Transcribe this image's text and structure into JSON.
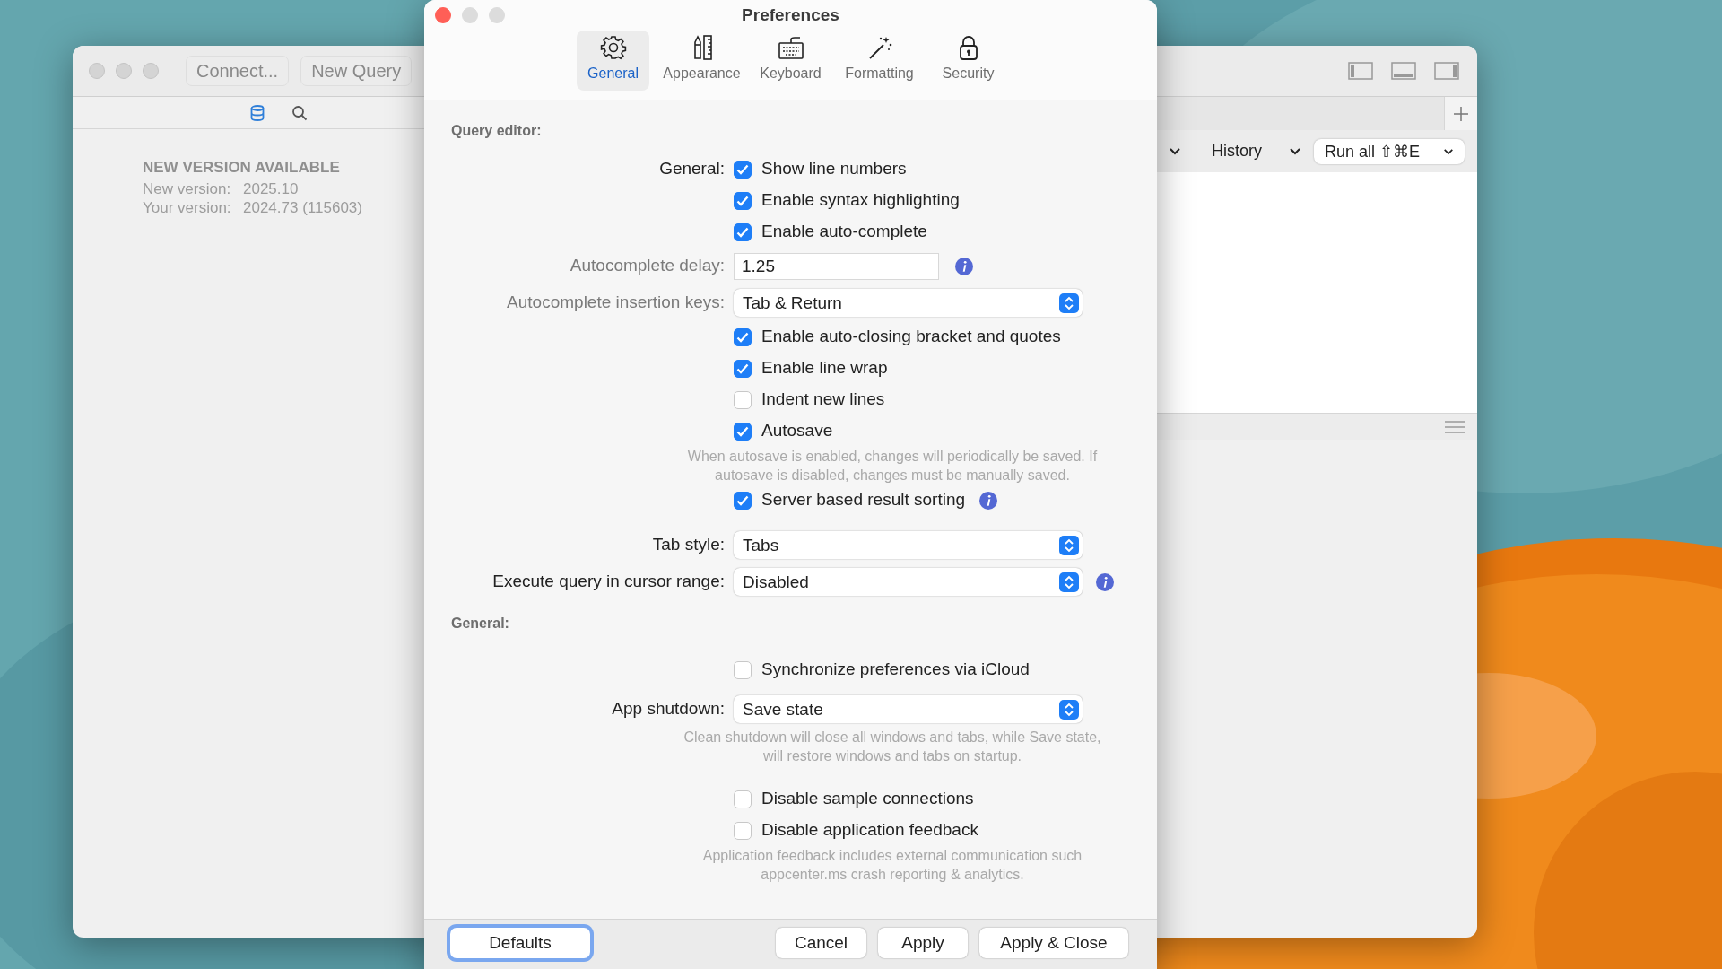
{
  "left_window": {
    "toolbar_buttons": [
      "Connect...",
      "New Query"
    ],
    "sidebar_tabs": [
      {
        "kind": "database",
        "selected": true
      },
      {
        "kind": "search",
        "selected": false
      }
    ],
    "notice": {
      "title": "NEW VERSION AVAILABLE",
      "rows": [
        {
          "label": "New version:",
          "value": "2025.10"
        },
        {
          "label": "Your version:",
          "value": "2024.73 (115603)"
        }
      ]
    }
  },
  "right_window": {
    "menus": [
      {
        "kind": "cut"
      },
      {
        "kind": "full",
        "label": "History"
      }
    ],
    "run_button": "Run all ⇧⌘E"
  },
  "prefs": {
    "title": "Preferences",
    "tabs": [
      {
        "kind": "gear",
        "label": "General",
        "selected": true
      },
      {
        "kind": "pencil",
        "label": "Appearance",
        "selected": false
      },
      {
        "kind": "keyboard",
        "label": "Keyboard",
        "selected": false
      },
      {
        "kind": "wand",
        "label": "Formatting",
        "selected": false
      },
      {
        "kind": "lock",
        "label": "Security",
        "selected": false
      }
    ],
    "sections": [
      {
        "heading": "Query editor:",
        "rows": [
          {
            "kind": "check",
            "label": "General:",
            "text": "Show line numbers",
            "checked": true
          },
          {
            "kind": "check",
            "text": "Enable syntax highlighting",
            "checked": true
          },
          {
            "kind": "check",
            "text": "Enable auto-complete",
            "checked": true
          },
          {
            "kind": "field",
            "label": "Autocomplete delay:",
            "label_dimmed": true,
            "value": "1.25",
            "info": true
          },
          {
            "kind": "select",
            "label": "Autocomplete insertion keys:",
            "label_dimmed": true,
            "value": "Tab & Return",
            "info": false
          },
          {
            "kind": "check",
            "text": "Enable auto-closing bracket and quotes",
            "checked": true
          },
          {
            "kind": "check",
            "text": "Enable line wrap",
            "checked": true
          },
          {
            "kind": "check",
            "text": "Indent new lines",
            "checked": false
          },
          {
            "kind": "check",
            "text": "Autosave",
            "checked": true
          },
          {
            "kind": "note",
            "text": "When autosave is enabled, changes will periodically be saved. If autosave is disabled, changes must be manually saved."
          },
          {
            "kind": "check",
            "text": "Server based result sorting",
            "checked": true,
            "info": true
          },
          {
            "kind": "select",
            "label": "Tab style:",
            "label_dimmed": false,
            "value": "Tabs",
            "info": false
          },
          {
            "kind": "select",
            "label": "Execute query in cursor range:",
            "label_dimmed": false,
            "value": "Disabled",
            "info": true
          }
        ]
      },
      {
        "heading": "General:",
        "rows": [
          {
            "kind": "check",
            "text": "Synchronize preferences via iCloud",
            "checked": false
          },
          {
            "kind": "select",
            "label": "App shutdown:",
            "label_dimmed": false,
            "value": "Save state",
            "info": false
          },
          {
            "kind": "note",
            "text": "Clean shutdown will close all windows and tabs, while Save state, will restore windows and tabs on startup."
          },
          {
            "kind": "check",
            "text": "Disable sample connections",
            "checked": false
          },
          {
            "kind": "check",
            "text": "Disable application feedback",
            "checked": false
          },
          {
            "kind": "note",
            "text": "Application feedback includes external communication such appcenter.ms crash reporting & analytics."
          }
        ]
      }
    ],
    "buttons": [
      {
        "label": "Defaults",
        "focused": true
      },
      {
        "label": "Cancel",
        "focused": false
      },
      {
        "label": "Apply",
        "focused": false
      },
      {
        "label": "Apply & Close",
        "focused": false
      }
    ]
  }
}
